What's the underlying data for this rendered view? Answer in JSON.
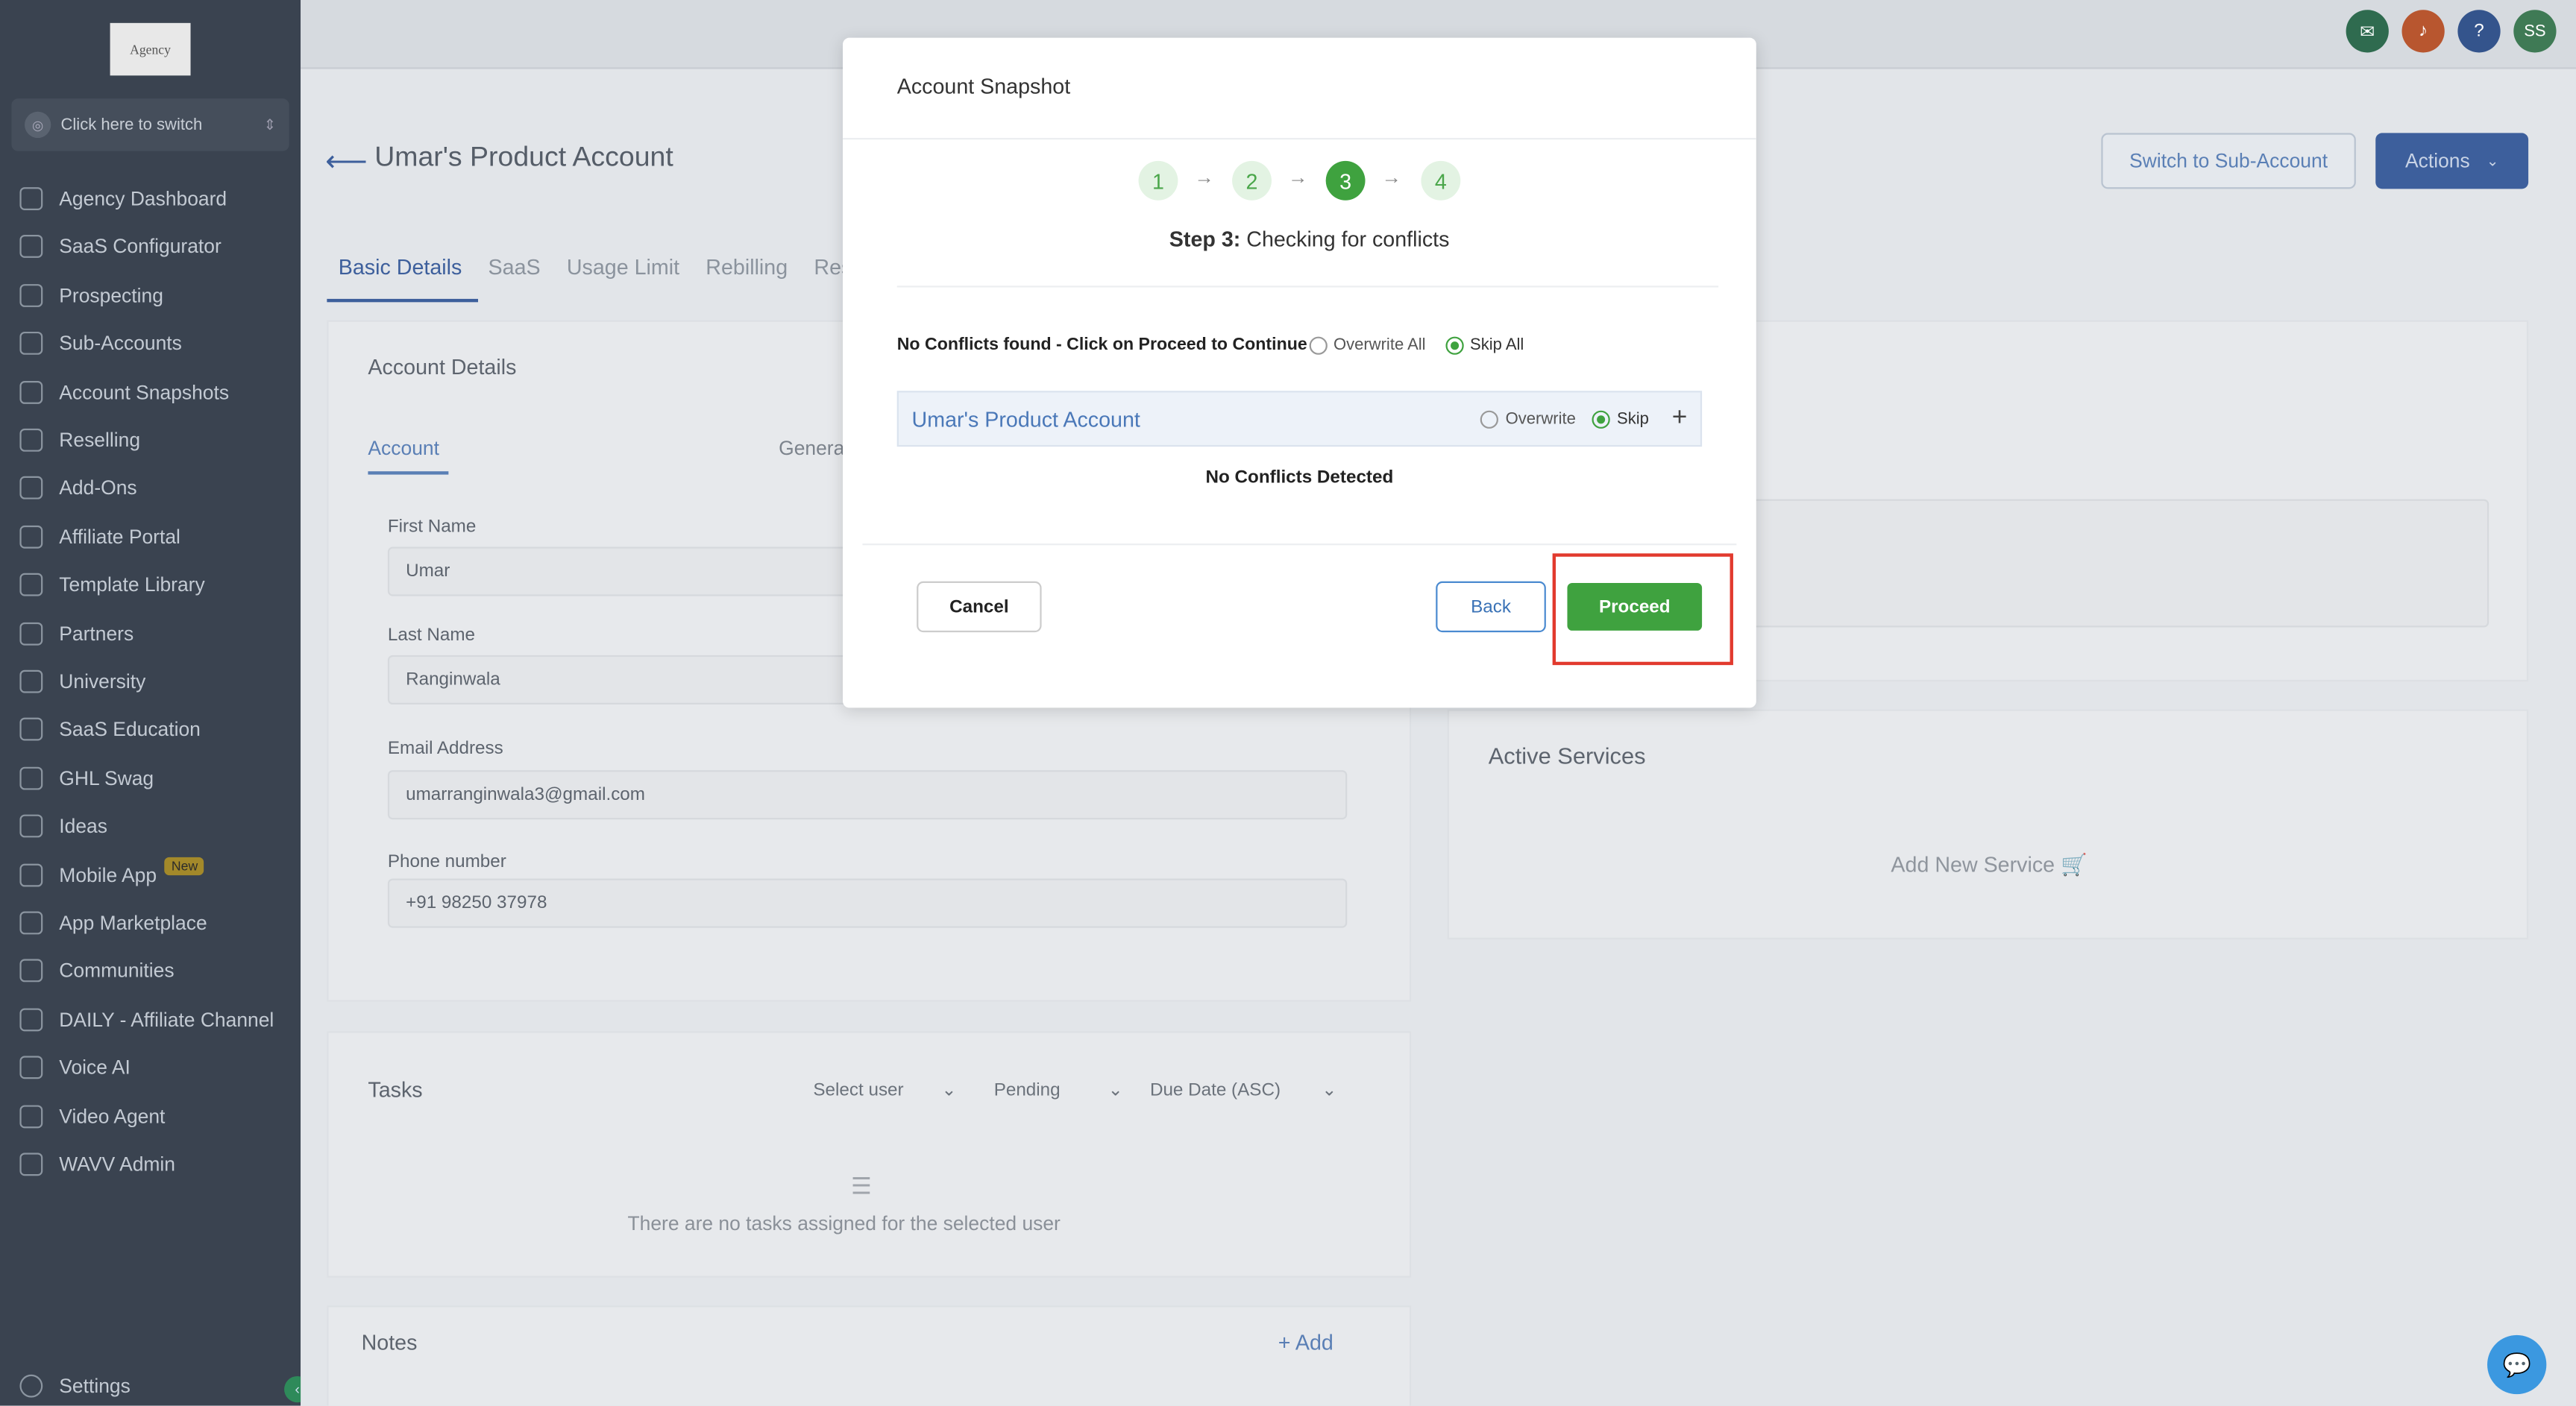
{
  "sidebar": {
    "logo_text": "Agency",
    "switcher_label": "Click here to switch",
    "items": [
      {
        "label": "Agency Dashboard"
      },
      {
        "label": "SaaS Configurator"
      },
      {
        "label": "Prospecting"
      },
      {
        "label": "Sub-Accounts"
      },
      {
        "label": "Account Snapshots"
      },
      {
        "label": "Reselling"
      },
      {
        "label": "Add-Ons"
      },
      {
        "label": "Affiliate Portal"
      },
      {
        "label": "Template Library"
      },
      {
        "label": "Partners"
      },
      {
        "label": "University"
      },
      {
        "label": "SaaS Education"
      },
      {
        "label": "GHL Swag"
      },
      {
        "label": "Ideas"
      },
      {
        "label": "Mobile App",
        "badge": "New"
      },
      {
        "label": "App Marketplace"
      },
      {
        "label": "Communities"
      },
      {
        "label": "DAILY - Affiliate Channel"
      },
      {
        "label": "Voice AI"
      },
      {
        "label": "Video Agent"
      },
      {
        "label": "WAVV Admin"
      }
    ],
    "settings_label": "Settings"
  },
  "topbar": {
    "avatar_initials": "SS",
    "help_label": "?"
  },
  "page": {
    "title": "Umar's Product Account",
    "switch_button": "Switch to Sub-Account",
    "actions_button": "Actions",
    "tabs": [
      "Basic Details",
      "SaaS",
      "Usage Limit",
      "Rebilling",
      "Res"
    ],
    "account_details_title": "Account Details",
    "subtabs": [
      "Account",
      "Genera"
    ],
    "fields": {
      "first_name_label": "First Name",
      "first_name_value": "Umar",
      "last_name_label": "Last Name",
      "last_name_value": "Ranginwala",
      "email_label": "Email Address",
      "email_value": "umarranginwala3@gmail.com",
      "phone_label": "Phone number",
      "phone_value": "+91 98250 37978"
    },
    "active_services_title": "Active Services",
    "add_service_label": "Add New Service",
    "tasks_title": "Tasks",
    "task_filters": [
      "Select user",
      "Pending",
      "Due Date (ASC)"
    ],
    "no_tasks_text": "There are no tasks assigned for the selected user",
    "notes_title": "Notes",
    "notes_add": "+ Add"
  },
  "modal": {
    "title": "Account Snapshot",
    "steps": [
      "1",
      "2",
      "3",
      "4"
    ],
    "current_step": 3,
    "step_prefix": "Step 3:",
    "step_text": "Checking for conflicts",
    "conflicts_message": "No Conflicts found - Click on Proceed to Continue",
    "overwrite_all_label": "Overwrite All",
    "skip_all_label": "Skip All",
    "account_name": "Umar's Product Account",
    "overwrite_label": "Overwrite",
    "skip_label": "Skip",
    "no_conflicts_text": "No Conflicts Detected",
    "cancel_label": "Cancel",
    "back_label": "Back",
    "proceed_label": "Proceed"
  },
  "colors": {
    "accent_green": "#3fa23f",
    "link_blue": "#4a78b8",
    "highlight_red": "#e23a2e",
    "sidebar_bg": "#3a4350"
  }
}
